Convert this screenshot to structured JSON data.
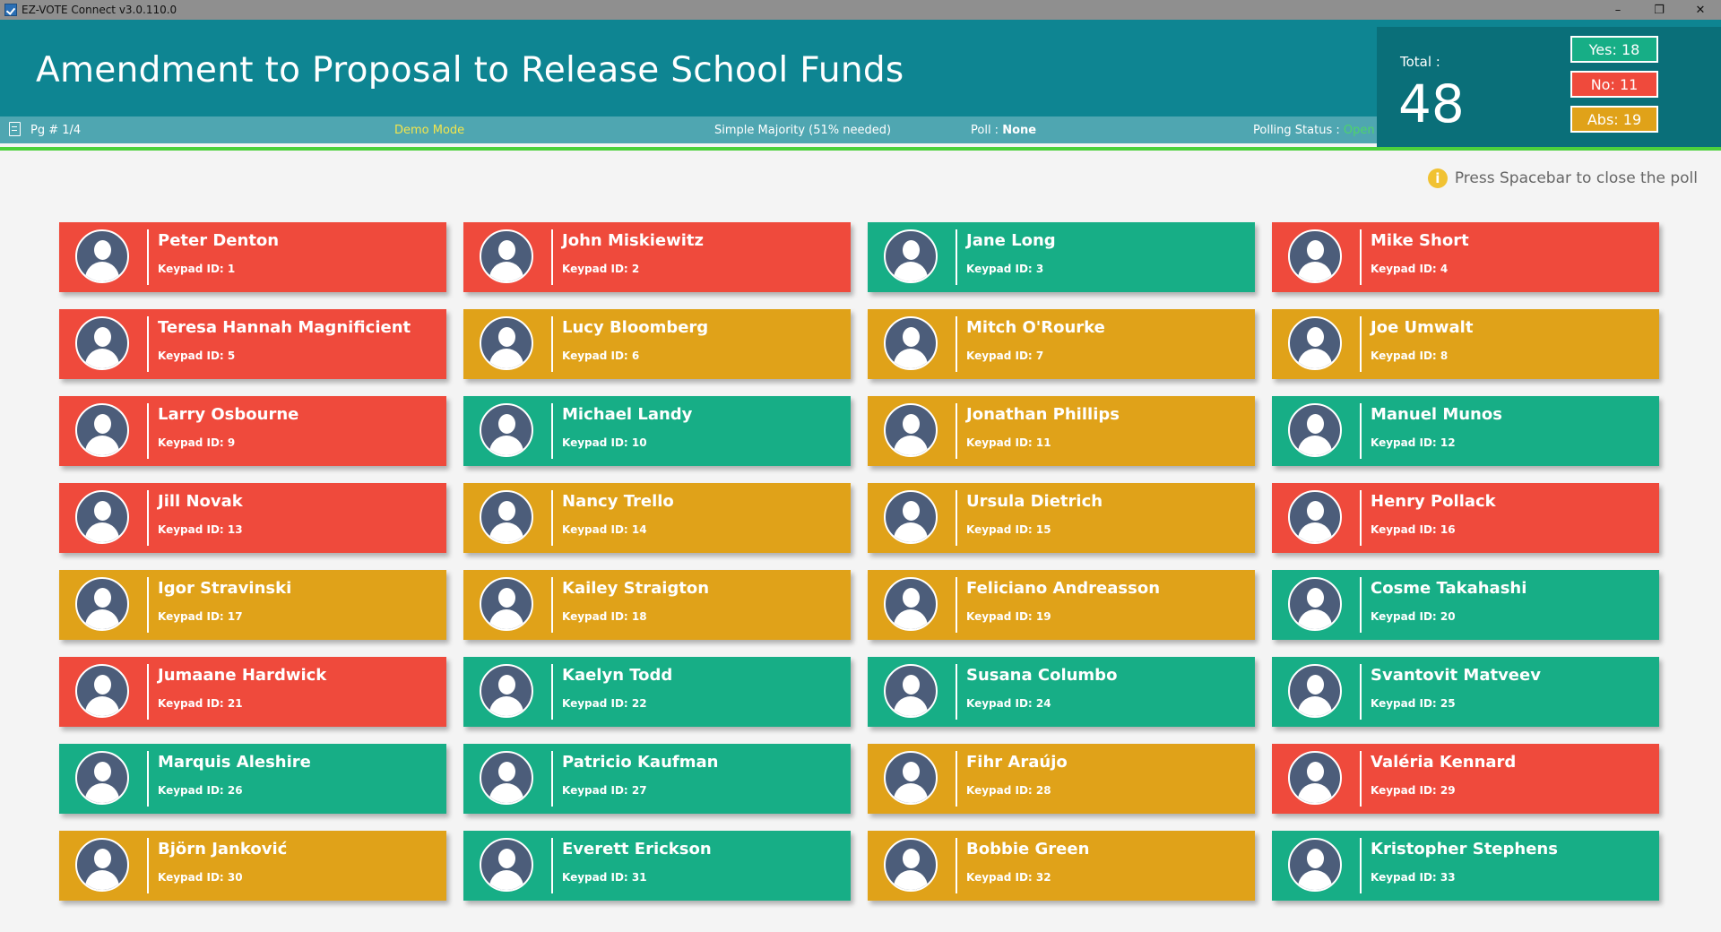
{
  "window": {
    "title": "EZ-VOTE Connect v3.0.110.0",
    "controls": [
      "–",
      "❐",
      "✕"
    ]
  },
  "header": {
    "title": "Amendment to Proposal to Release School Funds"
  },
  "status": {
    "page": "Pg # 1/4",
    "mode": "Demo Mode",
    "majority": "Simple Majority (51% needed)",
    "poll_label": "Poll :",
    "poll_value": "None",
    "polling_label": "Polling Status :",
    "polling_value": "Open"
  },
  "totals": {
    "total_label": "Total :",
    "total_value": "48",
    "yes": "Yes: 18",
    "no": "No: 11",
    "abs": "Abs: 19"
  },
  "hint": "Press Spacebar to close the poll",
  "colors": {
    "yes": "#17ae86",
    "no": "#ef4a3c",
    "abs": "#e0a219",
    "header": "#0e8592",
    "status_open": "#4ed36a"
  },
  "voters": [
    {
      "name": "Peter Denton",
      "keypad": "Keypad ID: 1",
      "vote": "no"
    },
    {
      "name": "John Miskiewitz",
      "keypad": "Keypad ID: 2",
      "vote": "no"
    },
    {
      "name": "Jane Long",
      "keypad": "Keypad ID: 3",
      "vote": "yes"
    },
    {
      "name": "Mike Short",
      "keypad": "Keypad ID: 4",
      "vote": "no"
    },
    {
      "name": "Teresa Hannah Magnificient",
      "keypad": "Keypad ID: 5",
      "vote": "no"
    },
    {
      "name": "Lucy Bloomberg",
      "keypad": "Keypad ID: 6",
      "vote": "abs"
    },
    {
      "name": "Mitch O'Rourke",
      "keypad": "Keypad ID: 7",
      "vote": "abs"
    },
    {
      "name": "Joe Umwalt",
      "keypad": "Keypad ID: 8",
      "vote": "abs"
    },
    {
      "name": "Larry Osbourne",
      "keypad": "Keypad ID: 9",
      "vote": "no"
    },
    {
      "name": "Michael Landy",
      "keypad": "Keypad ID: 10",
      "vote": "yes"
    },
    {
      "name": "Jonathan Phillips",
      "keypad": "Keypad ID: 11",
      "vote": "abs"
    },
    {
      "name": "Manuel Munos",
      "keypad": "Keypad ID: 12",
      "vote": "yes"
    },
    {
      "name": "Jill Novak",
      "keypad": "Keypad ID: 13",
      "vote": "no"
    },
    {
      "name": "Nancy Trello",
      "keypad": "Keypad ID: 14",
      "vote": "abs"
    },
    {
      "name": "Ursula Dietrich",
      "keypad": "Keypad ID: 15",
      "vote": "abs"
    },
    {
      "name": "Henry Pollack",
      "keypad": "Keypad ID: 16",
      "vote": "no"
    },
    {
      "name": "Igor Stravinski",
      "keypad": "Keypad ID: 17",
      "vote": "abs"
    },
    {
      "name": "Kailey Straigton",
      "keypad": "Keypad ID: 18",
      "vote": "abs"
    },
    {
      "name": "Feliciano Andreasson",
      "keypad": "Keypad ID: 19",
      "vote": "abs"
    },
    {
      "name": "Cosme Takahashi",
      "keypad": "Keypad ID: 20",
      "vote": "yes"
    },
    {
      "name": "Jumaane Hardwick",
      "keypad": "Keypad ID: 21",
      "vote": "no"
    },
    {
      "name": "Kaelyn Todd",
      "keypad": "Keypad ID: 22",
      "vote": "yes"
    },
    {
      "name": "Susana Columbo",
      "keypad": "Keypad ID: 24",
      "vote": "yes"
    },
    {
      "name": "Svantovit Matveev",
      "keypad": "Keypad ID: 25",
      "vote": "yes"
    },
    {
      "name": "Marquis Aleshire",
      "keypad": "Keypad ID: 26",
      "vote": "yes"
    },
    {
      "name": "Patricio Kaufman",
      "keypad": "Keypad ID: 27",
      "vote": "yes"
    },
    {
      "name": "Fihr Araújo",
      "keypad": "Keypad ID: 28",
      "vote": "abs"
    },
    {
      "name": "Valéria Kennard",
      "keypad": "Keypad ID: 29",
      "vote": "no"
    },
    {
      "name": "Björn Janković",
      "keypad": "Keypad ID: 30",
      "vote": "abs"
    },
    {
      "name": "Everett Erickson",
      "keypad": "Keypad ID: 31",
      "vote": "yes"
    },
    {
      "name": "Bobbie Green",
      "keypad": "Keypad ID: 32",
      "vote": "abs"
    },
    {
      "name": "Kristopher Stephens",
      "keypad": "Keypad ID: 33",
      "vote": "yes"
    }
  ]
}
